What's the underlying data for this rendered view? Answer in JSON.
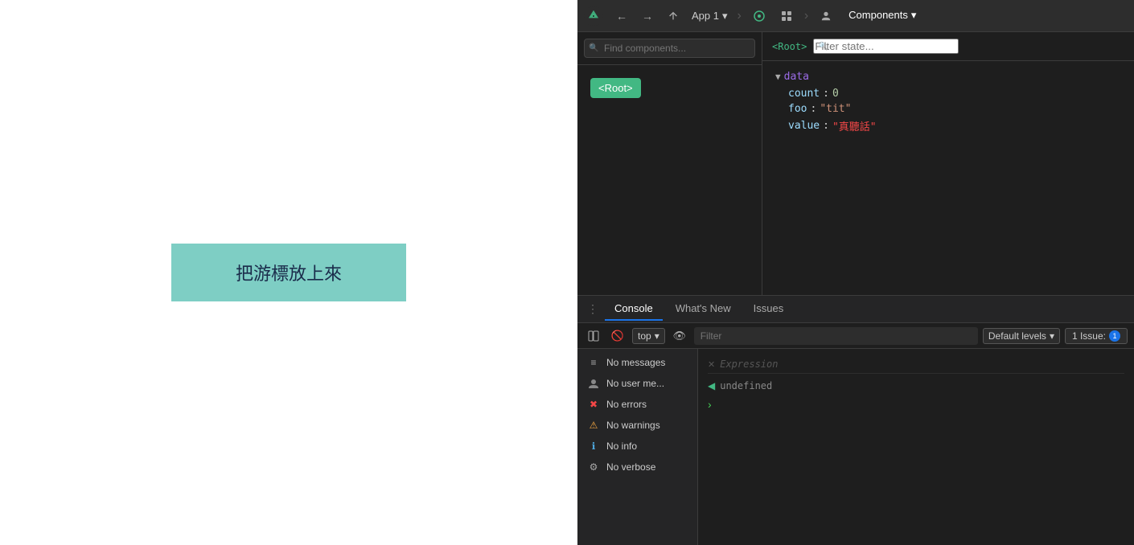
{
  "app_preview": {
    "button_label": "把游標放上來"
  },
  "devtools": {
    "toolbar": {
      "app_label": "App 1",
      "chevron": "›",
      "components_label": "Components",
      "back_arrow": "←",
      "forward_arrow": "→"
    },
    "component_tree": {
      "find_placeholder": "Find components...",
      "root_label": "<Root>"
    },
    "state_inspector": {
      "root_tag": "<Root>",
      "filter_placeholder": "Filter state...",
      "data_group": "data",
      "props": [
        {
          "key": "count",
          "value": "0",
          "type": "number"
        },
        {
          "key": "foo",
          "value": "\"tit\"",
          "type": "string"
        },
        {
          "key": "value",
          "value": "\"真聽話\"",
          "type": "string-chinese"
        }
      ]
    },
    "console": {
      "tabs": [
        {
          "label": "Console",
          "active": true
        },
        {
          "label": "What's New",
          "active": false
        },
        {
          "label": "Issues",
          "active": false
        }
      ],
      "toolbar": {
        "top_label": "top",
        "filter_placeholder": "Filter",
        "default_levels_label": "Default levels",
        "issue_label": "1 Issue:",
        "issue_count": "1"
      },
      "filter_items": [
        {
          "icon": "≡",
          "icon_class": "icon-list",
          "label": "No messages"
        },
        {
          "icon": "👤",
          "icon_class": "icon-user",
          "label": "No user me..."
        },
        {
          "icon": "✖",
          "icon_class": "icon-error",
          "label": "No errors"
        },
        {
          "icon": "⚠",
          "icon_class": "icon-warning",
          "label": "No warnings"
        },
        {
          "icon": "ℹ",
          "icon_class": "icon-info",
          "label": "No info"
        },
        {
          "icon": "⚙",
          "icon_class": "icon-verbose",
          "label": "No verbose"
        }
      ],
      "output": {
        "expression_placeholder": "Expression",
        "result_value": "undefined",
        "prompt_arrow": ">"
      }
    }
  }
}
